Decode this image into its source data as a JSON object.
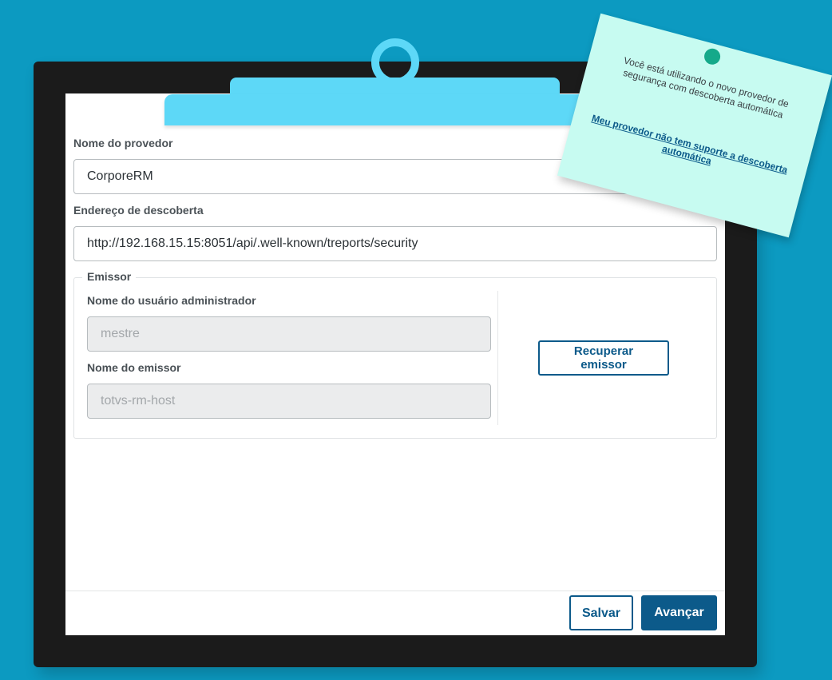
{
  "form": {
    "provider_name_label": "Nome do provedor",
    "provider_name_value": "CorporeRM",
    "discovery_address_label": "Endereço de descoberta",
    "discovery_address_value": "http://192.168.15.15:8051/api/.well-known/treports/security",
    "issuer_section": {
      "legend": "Emissor",
      "admin_user_label": "Nome do usuário administrador",
      "admin_user_placeholder": "mestre",
      "issuer_name_label": "Nome do emissor",
      "issuer_name_placeholder": "totvs-rm-host",
      "retrieve_button_label": "Recuperar emissor"
    }
  },
  "footer": {
    "save_label": "Salvar",
    "next_label": "Avançar"
  },
  "sticky_note": {
    "message": "Você está utilizando o novo provedor de segurança com descoberta automática",
    "link_text": "Meu provedor não tem suporte a descoberta automática"
  },
  "colors": {
    "background": "#0c9ac1",
    "board": "#1b1b1b",
    "clip": "#5dd8f7",
    "primary": "#0c5a8a",
    "note": "#c7fbf1",
    "pin": "#15a98a"
  }
}
